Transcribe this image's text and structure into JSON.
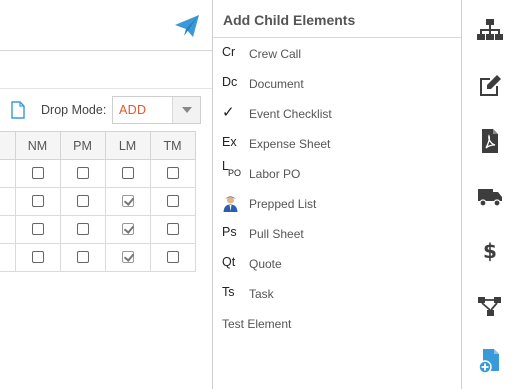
{
  "toolbar": {
    "drop_mode_label": "Drop Mode:",
    "drop_mode_value": "ADD"
  },
  "grid": {
    "columns": [
      "NM",
      "PM",
      "LM",
      "TM"
    ],
    "rows": [
      [
        false,
        false,
        false,
        false
      ],
      [
        false,
        false,
        true,
        false
      ],
      [
        false,
        false,
        true,
        false
      ],
      [
        false,
        false,
        true,
        false
      ]
    ]
  },
  "panel": {
    "title": "Add Child Elements",
    "items": [
      {
        "abbr": "Cr",
        "label": "Crew Call",
        "icon": "crew-call-icon"
      },
      {
        "abbr": "Dc",
        "label": "Document",
        "icon": "document-icon"
      },
      {
        "abbr": "✓",
        "label": "Event Checklist",
        "icon": "checkmark-icon"
      },
      {
        "abbr": "Ex",
        "label": "Expense Sheet",
        "icon": "expense-sheet-icon"
      },
      {
        "abbr": "L",
        "sub": "PO",
        "label": "Labor PO",
        "icon": "labor-po-icon"
      },
      {
        "abbr": "",
        "label": "Prepped List",
        "icon": "person-avatar-icon"
      },
      {
        "abbr": "Ps",
        "label": "Pull Sheet",
        "icon": "pull-sheet-icon"
      },
      {
        "abbr": "Qt",
        "label": "Quote",
        "icon": "quote-icon"
      },
      {
        "abbr": "Ts",
        "label": "Task",
        "icon": "task-icon"
      },
      {
        "abbr": "",
        "label": "Test Element",
        "icon": ""
      }
    ]
  },
  "rail": [
    "org-chart-icon",
    "edit-icon",
    "pdf-file-icon",
    "truck-icon",
    "dollar-icon",
    "workflow-icon",
    "add-document-icon"
  ],
  "colors": {
    "accent_blue": "#3a9ad9",
    "drop_value": "#e4572e",
    "icon_dark": "#3d3d3d"
  }
}
